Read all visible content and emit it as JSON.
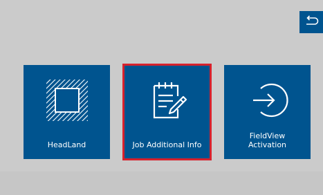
{
  "colors": {
    "background": "#cbcbcb",
    "tile": "#00548f",
    "selected_border": "#d7212c",
    "text": "#ffffff"
  },
  "back_button": {
    "icon": "undo-arrow-icon"
  },
  "tiles": [
    {
      "label": "HeadLand",
      "icon": "headland-square-icon",
      "selected": false
    },
    {
      "label": "Job Additional Info",
      "icon": "notepad-pencil-icon",
      "selected": true
    },
    {
      "label": "FieldView\nActivation",
      "icon": "login-arrow-circle-icon",
      "selected": false
    }
  ]
}
